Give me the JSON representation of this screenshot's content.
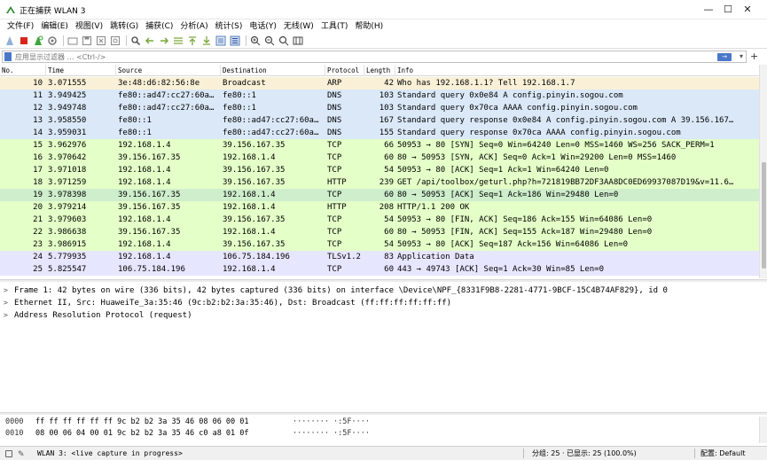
{
  "window": {
    "title": "正在捕获 WLAN 3",
    "minimize_glyph": "—",
    "maximize_glyph": "☐",
    "close_glyph": "✕"
  },
  "menu": [
    "文件(F)",
    "编辑(E)",
    "视图(V)",
    "跳转(G)",
    "捕获(C)",
    "分析(A)",
    "统计(S)",
    "电话(Y)",
    "无线(W)",
    "工具(T)",
    "帮助(H)"
  ],
  "toolbar": {
    "icons": [
      "start-capture-icon",
      "stop-capture-icon",
      "restart-capture-icon",
      "capture-options-icon",
      "open-file-icon",
      "save-file-icon",
      "close-file-icon",
      "reload-icon",
      "find-packet-icon",
      "go-back-icon",
      "go-forward-icon",
      "go-to-packet-icon",
      "go-first-icon",
      "go-last-icon",
      "autoscroll-icon",
      "colorize-icon",
      "zoom-in-icon",
      "zoom-out-icon",
      "zoom-normal-icon",
      "resize-columns-icon"
    ]
  },
  "filter": {
    "placeholder": "应用显示过滤器 … <Ctrl-/>",
    "apply_glyph": "→",
    "dropdown_glyph": "▾",
    "add_glyph": "+"
  },
  "packet_list": {
    "columns": [
      "No.",
      "Time",
      "Source",
      "Destination",
      "Protocol",
      "Length",
      "Info"
    ],
    "rows": [
      {
        "no": "10",
        "time": "3.071555",
        "src": "3e:48:d6:82:56:8e",
        "dst": "Broadcast",
        "proto": "ARP",
        "len": "42",
        "info": "Who has 192.168.1.1? Tell 192.168.1.7",
        "bg": "#faf0d7"
      },
      {
        "no": "11",
        "time": "3.949425",
        "src": "fe80::ad47:cc27:60a…",
        "dst": "fe80::1",
        "proto": "DNS",
        "len": "103",
        "info": "Standard query 0x0e84 A config.pinyin.sogou.com",
        "bg": "#dae8f8"
      },
      {
        "no": "12",
        "time": "3.949748",
        "src": "fe80::ad47:cc27:60a…",
        "dst": "fe80::1",
        "proto": "DNS",
        "len": "103",
        "info": "Standard query 0x70ca AAAA config.pinyin.sogou.com",
        "bg": "#dae8f8"
      },
      {
        "no": "13",
        "time": "3.958550",
        "src": "fe80::1",
        "dst": "fe80::ad47:cc27:60a…",
        "proto": "DNS",
        "len": "167",
        "info": "Standard query response 0x0e84 A config.pinyin.sogou.com A 39.156.167…",
        "bg": "#dae8f8"
      },
      {
        "no": "14",
        "time": "3.959031",
        "src": "fe80::1",
        "dst": "fe80::ad47:cc27:60a…",
        "proto": "DNS",
        "len": "155",
        "info": "Standard query response 0x70ca AAAA config.pinyin.sogou.com",
        "bg": "#dae8f8"
      },
      {
        "no": "15",
        "time": "3.962976",
        "src": "192.168.1.4",
        "dst": "39.156.167.35",
        "proto": "TCP",
        "len": "66",
        "info": "50953 → 80 [SYN] Seq=0 Win=64240 Len=0 MSS=1460 WS=256 SACK_PERM=1",
        "bg": "#e4ffc7"
      },
      {
        "no": "16",
        "time": "3.970642",
        "src": "39.156.167.35",
        "dst": "192.168.1.4",
        "proto": "TCP",
        "len": "60",
        "info": "80 → 50953 [SYN, ACK] Seq=0 Ack=1 Win=29200 Len=0 MSS=1460",
        "bg": "#e4ffc7"
      },
      {
        "no": "17",
        "time": "3.971018",
        "src": "192.168.1.4",
        "dst": "39.156.167.35",
        "proto": "TCP",
        "len": "54",
        "info": "50953 → 80 [ACK] Seq=1 Ack=1 Win=64240 Len=0",
        "bg": "#e4ffc7"
      },
      {
        "no": "18",
        "time": "3.971259",
        "src": "192.168.1.4",
        "dst": "39.156.167.35",
        "proto": "HTTP",
        "len": "239",
        "info": "GET /api/toolbox/geturl.php?h=721819BB72DF3AA8DC0ED69937087D19&v=11.6…",
        "bg": "#e4ffc7"
      },
      {
        "no": "19",
        "time": "3.978398",
        "src": "39.156.167.35",
        "dst": "192.168.1.4",
        "proto": "TCP",
        "len": "60",
        "info": "80 → 50953 [ACK] Seq=1 Ack=186 Win=29480 Len=0",
        "bg": "#cfeecc"
      },
      {
        "no": "20",
        "time": "3.979214",
        "src": "39.156.167.35",
        "dst": "192.168.1.4",
        "proto": "HTTP",
        "len": "208",
        "info": "HTTP/1.1 200 OK",
        "bg": "#e4ffc7"
      },
      {
        "no": "21",
        "time": "3.979603",
        "src": "192.168.1.4",
        "dst": "39.156.167.35",
        "proto": "TCP",
        "len": "54",
        "info": "50953 → 80 [FIN, ACK] Seq=186 Ack=155 Win=64086 Len=0",
        "bg": "#e4ffc7"
      },
      {
        "no": "22",
        "time": "3.986638",
        "src": "39.156.167.35",
        "dst": "192.168.1.4",
        "proto": "TCP",
        "len": "60",
        "info": "80 → 50953 [FIN, ACK] Seq=155 Ack=187 Win=29480 Len=0",
        "bg": "#e4ffc7"
      },
      {
        "no": "23",
        "time": "3.986915",
        "src": "192.168.1.4",
        "dst": "39.156.167.35",
        "proto": "TCP",
        "len": "54",
        "info": "50953 → 80 [ACK] Seq=187 Ack=156 Win=64086 Len=0",
        "bg": "#e4ffc7"
      },
      {
        "no": "24",
        "time": "5.779935",
        "src": "192.168.1.4",
        "dst": "106.75.184.196",
        "proto": "TLSv1.2",
        "len": "83",
        "info": "Application Data",
        "bg": "#e7e6ff"
      },
      {
        "no": "25",
        "time": "5.825547",
        "src": "106.75.184.196",
        "dst": "192.168.1.4",
        "proto": "TCP",
        "len": "60",
        "info": "443 → 49743 [ACK] Seq=1 Ack=30 Win=85 Len=0",
        "bg": "#e7e6ff"
      }
    ]
  },
  "details": [
    {
      "expander": ">",
      "text": "Frame 1: 42 bytes on wire (336 bits), 42 bytes captured (336 bits) on interface \\Device\\NPF_{8331F9B8-2281-4771-9BCF-15C4B74AF829}, id 0"
    },
    {
      "expander": ">",
      "text": "Ethernet II, Src: HuaweiTe_3a:35:46 (9c:b2:b2:3a:35:46), Dst: Broadcast (ff:ff:ff:ff:ff:ff)"
    },
    {
      "expander": ">",
      "text": "Address Resolution Protocol (request)"
    }
  ],
  "bytes": [
    {
      "offset": "0000",
      "hex": "ff ff ff ff ff ff 9c b2  b2 3a 35 46 08 06 00 01",
      "ascii": "········ ·:5F····"
    },
    {
      "offset": "0010",
      "hex": "08 00 06 04 00 01 9c b2  b2 3a 35 46 c0 a8 01 0f",
      "ascii": "········ ·:5F····"
    }
  ],
  "status": {
    "capture": "WLAN 3: <live capture in progress>",
    "counts": "分组: 25 · 已显示: 25 (100.0%)",
    "profile": "配置: Default"
  }
}
